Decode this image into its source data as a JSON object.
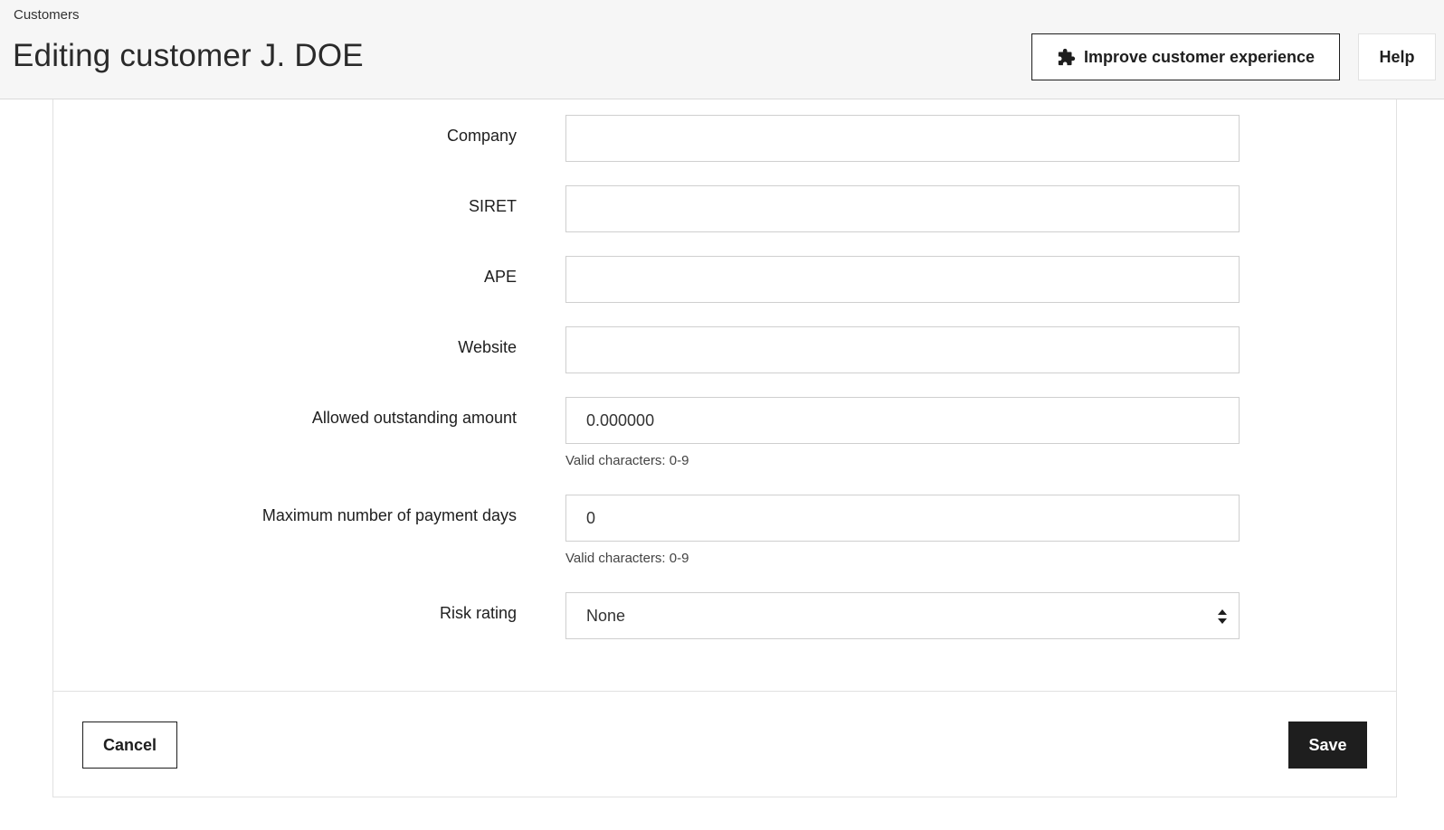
{
  "header": {
    "breadcrumb": "Customers",
    "title": "Editing customer J. DOE",
    "improve_button": {
      "label": "Improve customer experience",
      "icon": "puzzle-piece-icon"
    },
    "help_button": {
      "label": "Help"
    }
  },
  "form": {
    "fields": [
      {
        "label": "Company",
        "value": ""
      },
      {
        "label": "SIRET",
        "value": ""
      },
      {
        "label": "APE",
        "value": ""
      },
      {
        "label": "Website",
        "value": ""
      },
      {
        "label": "Allowed outstanding amount",
        "value": "0.000000",
        "helper": "Valid characters: 0-9"
      },
      {
        "label": "Maximum number of payment days",
        "value": "0",
        "helper": "Valid characters: 0-9"
      }
    ],
    "risk_rating": {
      "label": "Risk rating",
      "selected": "None",
      "icon": "select-arrows-icon"
    }
  },
  "footer": {
    "cancel_label": "Cancel",
    "save_label": "Save"
  },
  "colors": {
    "header_bg": "#f6f6f6",
    "primary_button_bg": "#1e1e1e",
    "border": "#cfcfcf"
  }
}
